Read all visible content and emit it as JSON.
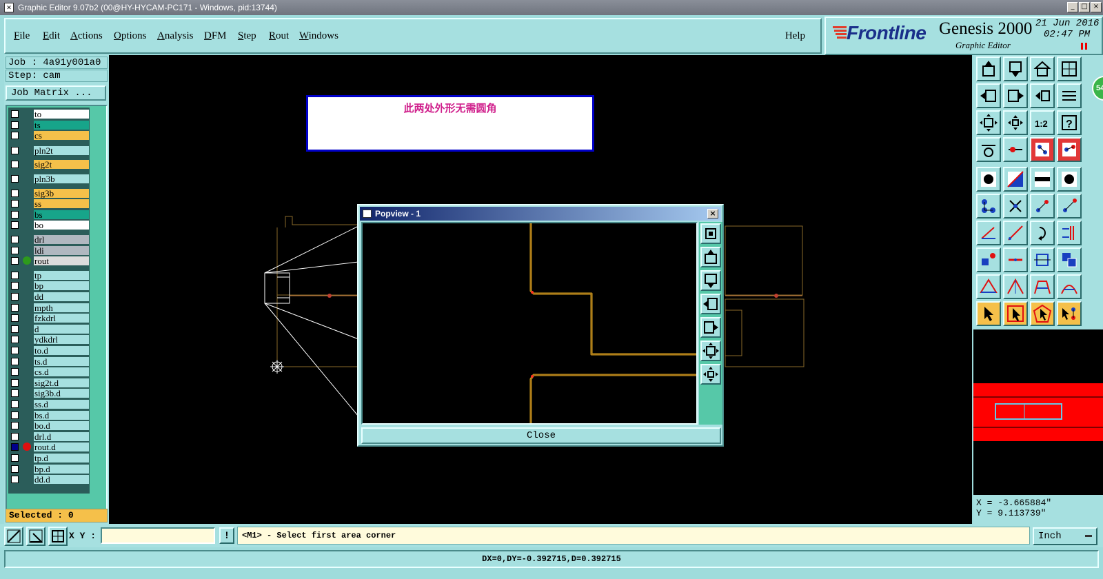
{
  "window": {
    "title": "Graphic Editor 9.07b2 (00@HY-HYCAM-PC171 - Windows, pid:13744)",
    "controls": [
      "_",
      "□",
      "×"
    ]
  },
  "menu": {
    "items": [
      "File",
      "Edit",
      "Actions",
      "Options",
      "Analysis",
      "DFM",
      "Step",
      "Rout",
      "Windows"
    ],
    "help": "Help"
  },
  "brand": {
    "logo": "Frontline",
    "product": "Genesis 2000",
    "subtitle": "Graphic Editor",
    "date": "21 Jun 2016",
    "time": "02:47 PM"
  },
  "job": {
    "job_line": "Job : 4a91y001a0",
    "step_line": "Step: cam",
    "matrix_button": "Job Matrix ..."
  },
  "layers": [
    {
      "name": "to",
      "color": "#ffffff"
    },
    {
      "name": "ts",
      "color": "#17a58a"
    },
    {
      "name": "cs",
      "color": "#f5c04a"
    },
    {
      "name": "pln2t",
      "color": "#a6e0e0"
    },
    {
      "name": "sig2t",
      "color": "#f5c04a"
    },
    {
      "name": "pln3b",
      "color": "#a6e0e0"
    },
    {
      "name": "sig3b",
      "color": "#f5c04a"
    },
    {
      "name": "ss",
      "color": "#f5c04a"
    },
    {
      "name": "bs",
      "color": "#17a58a"
    },
    {
      "name": "bo",
      "color": "#ffffff"
    },
    {
      "name": "drl",
      "color": "#b0b8c0"
    },
    {
      "name": "ldi",
      "color": "#b0b8c0"
    },
    {
      "name": "rout",
      "color": "#dcdcdc",
      "dot": "#2e9a1c"
    },
    {
      "name": "tp",
      "color": "#a6e0e0"
    },
    {
      "name": "bp",
      "color": "#a6e0e0"
    },
    {
      "name": "dd",
      "color": "#a6e0e0"
    },
    {
      "name": "mpth",
      "color": "#a6e0e0"
    },
    {
      "name": "fzkdrl",
      "color": "#a6e0e0"
    },
    {
      "name": "d",
      "color": "#a6e0e0"
    },
    {
      "name": "ydkdrl",
      "color": "#a6e0e0"
    },
    {
      "name": "to.d",
      "color": "#a6e0e0"
    },
    {
      "name": "ts.d",
      "color": "#a6e0e0"
    },
    {
      "name": "cs.d",
      "color": "#a6e0e0"
    },
    {
      "name": "sig2t.d",
      "color": "#a6e0e0"
    },
    {
      "name": "sig3b.d",
      "color": "#a6e0e0"
    },
    {
      "name": "ss.d",
      "color": "#a6e0e0"
    },
    {
      "name": "bs.d",
      "color": "#a6e0e0"
    },
    {
      "name": "bo.d",
      "color": "#a6e0e0"
    },
    {
      "name": "drl.d",
      "color": "#a6e0e0"
    },
    {
      "name": "rout.d",
      "color": "#a6e0e0",
      "dot": "#e01010",
      "checked": true
    },
    {
      "name": "tp.d",
      "color": "#a6e0e0"
    },
    {
      "name": "bp.d",
      "color": "#a6e0e0"
    },
    {
      "name": "dd.d",
      "color": "#a6e0e0"
    }
  ],
  "selected": "Selected : 0",
  "note": {
    "text": "此两处外形无需圆角"
  },
  "popview": {
    "title": "Popview - 1",
    "close_label": "Close"
  },
  "status_badge": "54",
  "coords": {
    "x": "X = -3.665884\"",
    "y": "Y = 9.113739\""
  },
  "command": {
    "xy_label": "X Y :",
    "xy_value": "",
    "warn": "!",
    "prompt": "<M1> - Select first area corner",
    "unit": "Inch"
  },
  "statusbar": "DX=0,DY=-0.392715,D=0.392715"
}
